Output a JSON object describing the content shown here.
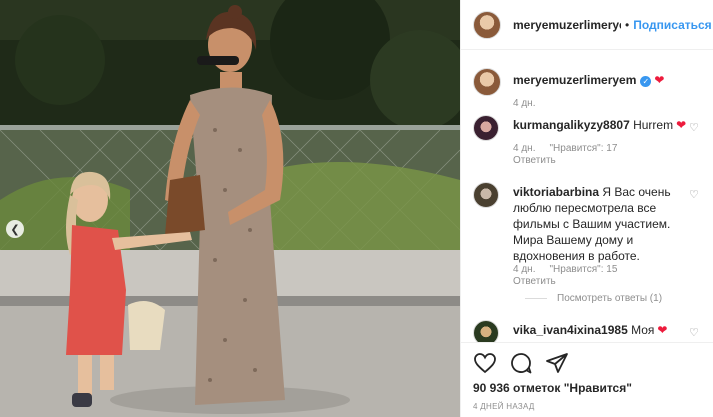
{
  "photo": {
    "alt_subject": "mother-and-daughter-photo",
    "prev_icon": "chevron-left-icon"
  },
  "header": {
    "username": "meryemuzerlimeryem",
    "separator": "•",
    "follow_label": "Подписаться"
  },
  "caption": {
    "username": "meryemuzerlimeryem",
    "verified_icon": "verified-badge-icon",
    "emoji": "❤",
    "time": "4 дн."
  },
  "comments": [
    {
      "username": "kurmangalikyzy8807",
      "text": "Hurrem",
      "emoji": "❤",
      "time": "4 дн.",
      "likes": "\"Нравится\": 17",
      "reply": "Ответить"
    },
    {
      "username": "viktoriabarbina",
      "text": "Я Вас очень люблю пересмотрела все фильмы с Вашим участием. Мира Вашему дому и вдохновения в работе.",
      "time": "4 дн.",
      "likes": "\"Нравится\": 15",
      "reply": "Ответить",
      "view_replies": "Посмотреть ответы (1)"
    },
    {
      "username": "vika_ivan4ixina1985",
      "text": "Моя",
      "emoji": "❤"
    }
  ],
  "footer": {
    "likes": "90 936 отметок \"Нравится\"",
    "ago": "4 ДНЕЙ НАЗАД"
  },
  "colors": {
    "link": "#3897f0",
    "muted": "#8e8e8e",
    "heart": "#ed1b3c"
  }
}
